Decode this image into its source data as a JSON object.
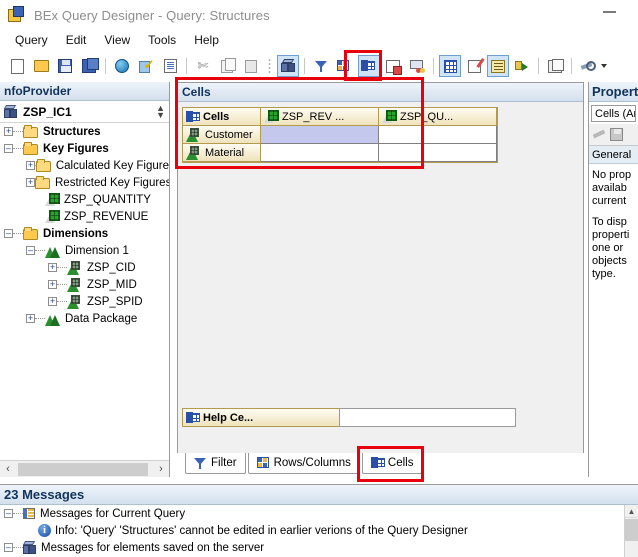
{
  "window": {
    "title": "BEx Query Designer - Query: Structures",
    "app_icon": "query-designer-icon",
    "minimize_label": "–"
  },
  "menubar": {
    "items": [
      {
        "label": "Query"
      },
      {
        "label": "Edit"
      },
      {
        "label": "View"
      },
      {
        "label": "Tools"
      },
      {
        "label": "Help"
      }
    ]
  },
  "toolbar": {
    "buttons": [
      {
        "name": "new-query-button",
        "icon": "new-document-icon",
        "title": "New"
      },
      {
        "name": "open-query-button",
        "icon": "open-folder-icon",
        "title": "Open"
      },
      {
        "name": "save-query-button",
        "icon": "save-disk-icon",
        "title": "Save"
      },
      {
        "name": "save-as-button",
        "icon": "save-as-icon",
        "title": "Save As"
      },
      {
        "name": "publish-button",
        "icon": "globe-icon",
        "title": "Publish"
      },
      {
        "name": "check-query-button",
        "icon": "check-mark-icon",
        "title": "Check"
      },
      {
        "name": "query-properties-button",
        "icon": "document-properties-icon",
        "title": "Query Properties"
      },
      {
        "name": "cut-button",
        "icon": "scissors-icon",
        "title": "Cut"
      },
      {
        "name": "copy-button",
        "icon": "copy-icon",
        "title": "Copy"
      },
      {
        "name": "paste-button",
        "icon": "paste-icon",
        "title": "Paste"
      },
      {
        "name": "infoprovider-button",
        "icon": "cube-icon",
        "title": "InfoProvider"
      },
      {
        "name": "filter-button",
        "icon": "filter-funnel-icon",
        "title": "Filter"
      },
      {
        "name": "rows-columns-button",
        "icon": "rows-columns-icon",
        "title": "Rows/Columns"
      },
      {
        "name": "cells-button",
        "icon": "cells-icon",
        "title": "Cells",
        "selected": true
      },
      {
        "name": "conditions-button",
        "icon": "conditions-icon",
        "title": "Conditions"
      },
      {
        "name": "exceptions-button",
        "icon": "exceptions-icon",
        "title": "Exceptions"
      },
      {
        "name": "table-display-button",
        "icon": "table-icon",
        "title": "Table"
      },
      {
        "name": "edit-note-button",
        "icon": "edit-note-icon",
        "title": "Documents"
      },
      {
        "name": "messages-button",
        "icon": "messages-list-icon",
        "title": "Messages",
        "selected": true
      },
      {
        "name": "technical-name-button",
        "icon": "arrow-box-icon",
        "title": "Technical Names"
      },
      {
        "name": "where-used-button",
        "icon": "where-used-icon",
        "title": "Where-Used List"
      },
      {
        "name": "settings-button",
        "icon": "wrench-icon",
        "title": "Settings"
      }
    ],
    "dropdown_caret": "▾"
  },
  "infoprovider": {
    "panel_title": "nfoProvider",
    "name": "ZSP_IC1",
    "icon": "cube-icon",
    "spinner": "↕",
    "tree": [
      {
        "label": "Structures",
        "icon": "folder-icon",
        "expander": "+",
        "bold": true,
        "indent": 0
      },
      {
        "label": "Key Figures",
        "icon": "folder-open-icon",
        "expander": "–",
        "bold": true,
        "indent": 0
      },
      {
        "label": "Calculated Key Figure",
        "icon": "folder-icon",
        "expander": "+",
        "bold": false,
        "indent": 1
      },
      {
        "label": "Restricted Key Figures",
        "icon": "folder-icon",
        "expander": "+",
        "bold": false,
        "indent": 1
      },
      {
        "label": "ZSP_QUANTITY",
        "icon": "key-figure-icon",
        "expander": "",
        "bold": false,
        "indent": 1
      },
      {
        "label": "ZSP_REVENUE",
        "icon": "key-figure-icon",
        "expander": "",
        "bold": false,
        "indent": 1
      },
      {
        "label": "Dimensions",
        "icon": "folder-open-icon",
        "expander": "–",
        "bold": true,
        "indent": 0
      },
      {
        "label": "Dimension 1",
        "icon": "dimension-icon",
        "expander": "–",
        "bold": false,
        "indent": 1
      },
      {
        "label": "ZSP_CID",
        "icon": "characteristic-icon",
        "expander": "+",
        "bold": false,
        "indent": 2
      },
      {
        "label": "ZSP_MID",
        "icon": "characteristic-icon",
        "expander": "+",
        "bold": false,
        "indent": 2
      },
      {
        "label": "ZSP_SPID",
        "icon": "characteristic-icon",
        "expander": "+",
        "bold": false,
        "indent": 2
      },
      {
        "label": "Data Package",
        "icon": "dimension-icon",
        "expander": "+",
        "bold": false,
        "indent": 1
      }
    ],
    "hscrollbar": {
      "left_arrow": "‹",
      "right_arrow": "›"
    }
  },
  "cells": {
    "panel_title": "Cells",
    "grid": {
      "corner_label": "Cells",
      "corner_icon": "cells-icon",
      "column_headers": [
        {
          "label": "ZSP_REV ...",
          "icon": "key-figure-icon"
        },
        {
          "label": "ZSP_QU...",
          "icon": "key-figure-icon"
        }
      ],
      "rows": [
        {
          "header": {
            "label": "Customer",
            "icon": "characteristic-icon"
          },
          "cells": [
            {
              "value": "",
              "selected": true
            },
            {
              "value": "",
              "selected": false
            }
          ]
        },
        {
          "header": {
            "label": "Material",
            "icon": "characteristic-icon"
          },
          "cells": [
            {
              "value": "",
              "selected": false
            },
            {
              "value": "",
              "selected": false
            }
          ]
        }
      ]
    },
    "help_center": {
      "label": "Help Ce...",
      "icon": "cells-icon",
      "value": ""
    }
  },
  "bottom_tabs": {
    "items": [
      {
        "label": "Filter",
        "icon": "filter-funnel-icon",
        "active": false
      },
      {
        "label": "Rows/Columns",
        "icon": "rows-columns-icon",
        "active": false
      },
      {
        "label": "Cells",
        "icon": "cells-icon",
        "active": true
      }
    ]
  },
  "properties": {
    "title": "Propert",
    "selector_value": "Cells (Are",
    "tools": [
      {
        "name": "pencil-icon",
        "label": ""
      },
      {
        "name": "save-icon",
        "label": ""
      }
    ],
    "section_label": "General",
    "body_lines": [
      "No prop",
      "availab",
      "current",
      "",
      "To disp",
      "properti",
      "one or ",
      "objects",
      "type."
    ]
  },
  "messages": {
    "title": "23 Messages",
    "rows": [
      {
        "label": "Messages for Current Query",
        "icon": "messages-list-icon",
        "expander": "–",
        "indent": 0
      },
      {
        "label": "Info: 'Query' 'Structures' cannot be edited in earlier verions of the Query Designer",
        "icon": "info-icon",
        "expander": "",
        "indent": 1
      },
      {
        "label": "Messages for elements saved on the server",
        "icon": "cube-icon",
        "expander": "–",
        "indent": 0
      }
    ],
    "scrollbar": {
      "up_arrow": "▲"
    }
  },
  "annotations": {
    "highlight_color": "#e8000d",
    "boxes": [
      {
        "name": "cells-toolbar-button-highlight"
      },
      {
        "name": "cells-panel-highlight"
      },
      {
        "name": "cells-tab-highlight"
      }
    ]
  }
}
